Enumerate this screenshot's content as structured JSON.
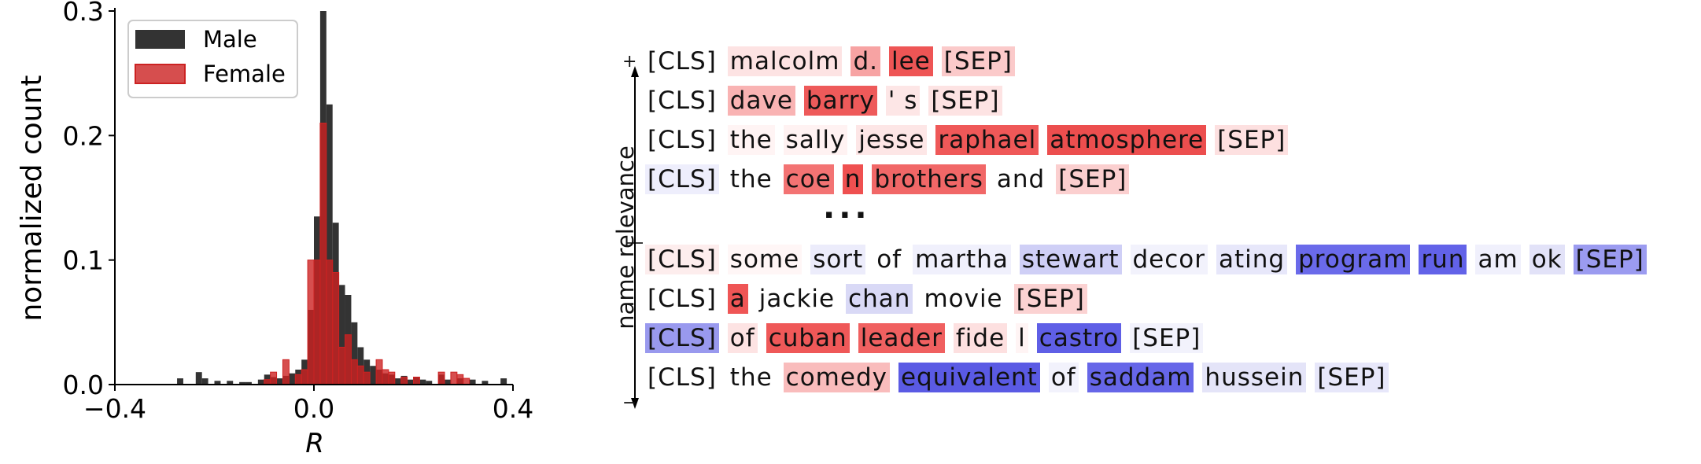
{
  "chart_data": [
    {
      "type": "histogram",
      "xlabel": "R",
      "ylabel": "normalized count",
      "xlim": [
        -0.4,
        0.4
      ],
      "ylim": [
        0.0,
        0.3
      ],
      "xticks": [
        "−0.4",
        "0.0",
        "0.4"
      ],
      "yticks": [
        "0.0",
        "0.1",
        "0.2",
        "0.3"
      ],
      "bin_width": 0.0125,
      "legend_position": "top-left",
      "series": [
        {
          "name": "Male",
          "color": "#333333",
          "bins": [
            [
              -0.275,
              0.005
            ],
            [
              -0.2375,
              0.01
            ],
            [
              -0.225,
              0.005
            ],
            [
              -0.2,
              0.003
            ],
            [
              -0.175,
              0.003
            ],
            [
              -0.15,
              0.002
            ],
            [
              -0.1375,
              0.002
            ],
            [
              -0.1125,
              0.004
            ],
            [
              -0.1,
              0.008
            ],
            [
              -0.0875,
              0.006
            ],
            [
              -0.075,
              0.005
            ],
            [
              -0.0625,
              0.007
            ],
            [
              -0.05,
              0.009
            ],
            [
              -0.0375,
              0.012
            ],
            [
              -0.025,
              0.02
            ],
            [
              -0.0125,
              0.06
            ],
            [
              0.0,
              0.135
            ],
            [
              0.0125,
              0.3
            ],
            [
              0.025,
              0.225
            ],
            [
              0.0375,
              0.13
            ],
            [
              0.05,
              0.08
            ],
            [
              0.0625,
              0.072
            ],
            [
              0.075,
              0.05
            ],
            [
              0.0875,
              0.03
            ],
            [
              0.1,
              0.02
            ],
            [
              0.1125,
              0.015
            ],
            [
              0.125,
              0.012
            ],
            [
              0.1375,
              0.009
            ],
            [
              0.15,
              0.008
            ],
            [
              0.1625,
              0.005
            ],
            [
              0.175,
              0.007
            ],
            [
              0.1875,
              0.004
            ],
            [
              0.2,
              0.006
            ],
            [
              0.2125,
              0.004
            ],
            [
              0.225,
              0.003
            ],
            [
              0.25,
              0.008
            ],
            [
              0.2625,
              0.004
            ],
            [
              0.2875,
              0.005
            ],
            [
              0.3125,
              0.004
            ],
            [
              0.3375,
              0.003
            ],
            [
              0.375,
              0.005
            ]
          ]
        },
        {
          "name": "Female",
          "color": "#cc2222",
          "bins": [
            [
              -0.1,
              0.004
            ],
            [
              -0.0875,
              0.01
            ],
            [
              -0.0625,
              0.02
            ],
            [
              -0.0375,
              0.008
            ],
            [
              -0.025,
              0.012
            ],
            [
              -0.0125,
              0.1
            ],
            [
              0.0,
              0.1
            ],
            [
              0.0125,
              0.21
            ],
            [
              0.025,
              0.1
            ],
            [
              0.0375,
              0.09
            ],
            [
              0.05,
              0.03
            ],
            [
              0.0625,
              0.04
            ],
            [
              0.075,
              0.02
            ],
            [
              0.0875,
              0.015
            ],
            [
              0.1,
              0.01
            ],
            [
              0.125,
              0.02
            ],
            [
              0.1375,
              0.012
            ],
            [
              0.15,
              0.01
            ],
            [
              0.175,
              0.006
            ],
            [
              0.2,
              0.006
            ],
            [
              0.25,
              0.01
            ],
            [
              0.275,
              0.01
            ],
            [
              0.2875,
              0.008
            ],
            [
              0.3,
              0.005
            ]
          ]
        }
      ]
    },
    {
      "type": "table",
      "axis_label": "name relevance",
      "plus_label": "+",
      "minus_label": "−",
      "ellipsis": "...",
      "rows": [
        {
          "tokens": [
            {
              "t": "[CLS]",
              "c": "#ffffff"
            },
            {
              "t": "malcolm",
              "c": "#fde3e3"
            },
            {
              "t": "d.",
              "c": "#f7a3a3"
            },
            {
              "t": "lee",
              "c": "#ee5555"
            },
            {
              "t": "[SEP]",
              "c": "#fbcaca"
            }
          ]
        },
        {
          "tokens": [
            {
              "t": "[CLS]",
              "c": "#ffffff"
            },
            {
              "t": "dave",
              "c": "#f9b3b3"
            },
            {
              "t": "barry",
              "c": "#ee5a5a"
            },
            {
              "t": "' s",
              "c": "#fde6e6"
            },
            {
              "t": "[SEP]",
              "c": "#fde3e3"
            }
          ]
        },
        {
          "tokens": [
            {
              "t": "[CLS]",
              "c": "#ffffff"
            },
            {
              "t": "the",
              "c": "#fff4f4"
            },
            {
              "t": "sally",
              "c": "#fff2f2"
            },
            {
              "t": "jesse",
              "c": "#fde6e6"
            },
            {
              "t": "raphael",
              "c": "#ef5858"
            },
            {
              "t": "atmosphere",
              "c": "#ec4e4e"
            },
            {
              "t": "[SEP]",
              "c": "#fde0e0"
            }
          ]
        },
        {
          "tokens": [
            {
              "t": "[CLS]",
              "c": "#eeeefc"
            },
            {
              "t": "the",
              "c": "#ffffff"
            },
            {
              "t": "coe",
              "c": "#f37373"
            },
            {
              "t": "n",
              "c": "#ef5050"
            },
            {
              "t": "brothers",
              "c": "#f16767"
            },
            {
              "t": "and",
              "c": "#ffffff"
            },
            {
              "t": "[SEP]",
              "c": "#fbcfcf"
            }
          ]
        },
        {
          "tokens": [
            {
              "t": "[CLS]",
              "c": "#fdeded"
            },
            {
              "t": "some",
              "c": "#fff6f6"
            },
            {
              "t": "sort",
              "c": "#ececfb"
            },
            {
              "t": "of",
              "c": "#ffffff"
            },
            {
              "t": "martha",
              "c": "#f0f0fc"
            },
            {
              "t": "stewart",
              "c": "#cfcff6"
            },
            {
              "t": "decor",
              "c": "#f2f2fc"
            },
            {
              "t": "ating",
              "c": "#e7e7fa"
            },
            {
              "t": "program",
              "c": "#6a6aea"
            },
            {
              "t": "run",
              "c": "#6262e8"
            },
            {
              "t": "am",
              "c": "#f0f0fc"
            },
            {
              "t": "ok",
              "c": "#e2e2f8"
            },
            {
              "t": "[SEP]",
              "c": "#9b9bf0"
            }
          ]
        },
        {
          "tokens": [
            {
              "t": "[CLS]",
              "c": "#ffffff"
            },
            {
              "t": "a",
              "c": "#ef5555"
            },
            {
              "t": "jackie",
              "c": "#ffffff"
            },
            {
              "t": "chan",
              "c": "#d9d9f6"
            },
            {
              "t": "movie",
              "c": "#ffffff"
            },
            {
              "t": "[SEP]",
              "c": "#fbd2d2"
            }
          ]
        },
        {
          "tokens": [
            {
              "t": "[CLS]",
              "c": "#9999ee"
            },
            {
              "t": "of",
              "c": "#fde3e3"
            },
            {
              "t": "cuban",
              "c": "#ef5858"
            },
            {
              "t": "leader",
              "c": "#f06060"
            },
            {
              "t": "fide",
              "c": "#fde0e0"
            },
            {
              "t": "l",
              "c": "#fff4f4"
            },
            {
              "t": "castro",
              "c": "#5f5fe6"
            },
            {
              "t": "[SEP]",
              "c": "#f2f2fc"
            }
          ]
        },
        {
          "tokens": [
            {
              "t": "[CLS]",
              "c": "#ffffff"
            },
            {
              "t": "the",
              "c": "#ffffff"
            },
            {
              "t": "comedy",
              "c": "#f9bcbc"
            },
            {
              "t": "equivalent",
              "c": "#5a5ae4"
            },
            {
              "t": "of",
              "c": "#f2f2fc"
            },
            {
              "t": "saddam",
              "c": "#6666e8"
            },
            {
              "t": "hussein",
              "c": "#e4e4f8"
            },
            {
              "t": "[SEP]",
              "c": "#e7e7fa"
            }
          ]
        }
      ]
    }
  ]
}
